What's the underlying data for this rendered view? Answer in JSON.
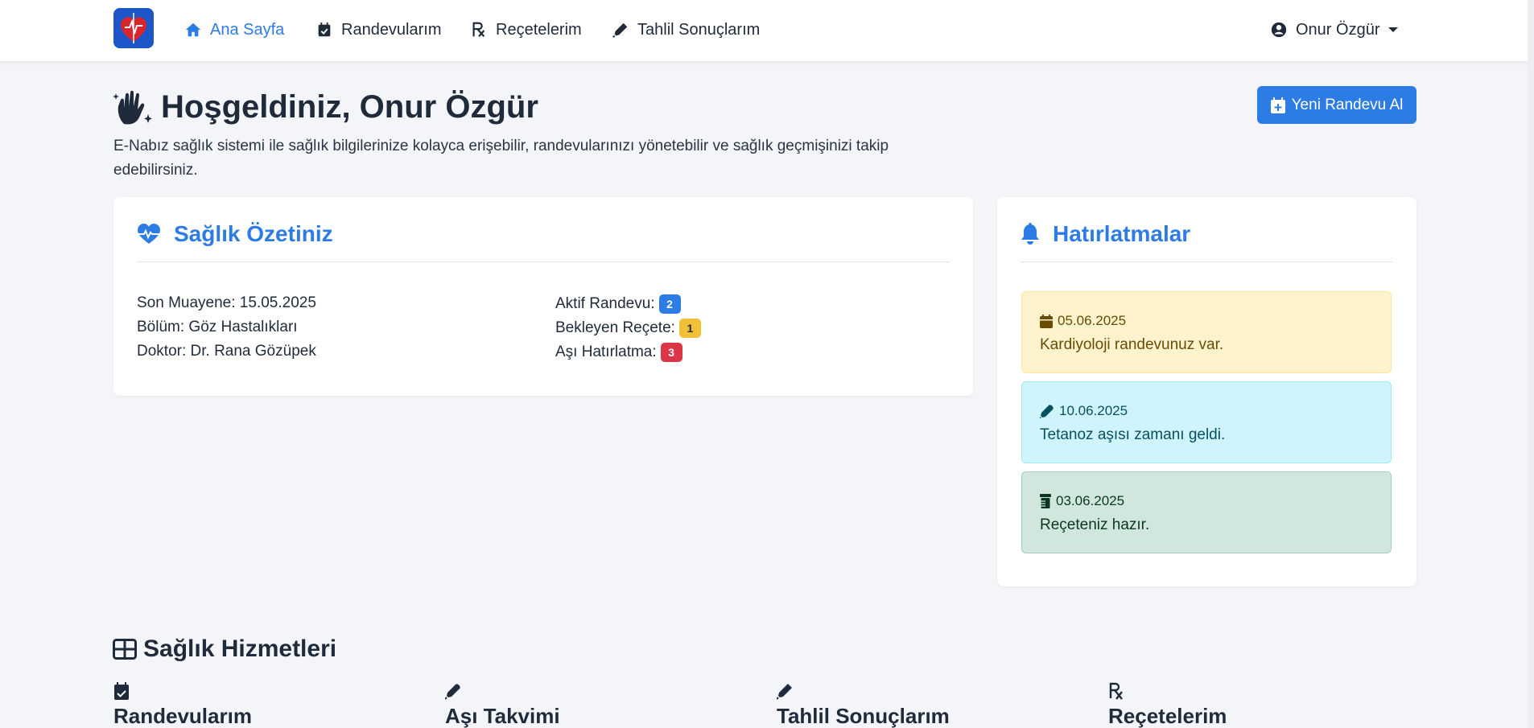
{
  "nav": {
    "items": [
      {
        "label": "Ana Sayfa",
        "icon": "home-icon",
        "active": true
      },
      {
        "label": "Randevularım",
        "icon": "calendar-check-icon",
        "active": false
      },
      {
        "label": "Reçetelerim",
        "icon": "prescription-icon",
        "active": false
      },
      {
        "label": "Tahlil Sonuçlarım",
        "icon": "syringe-icon",
        "active": false
      }
    ],
    "user_name": "Onur Özgür"
  },
  "header": {
    "title": "Hoşgeldiniz, Onur Özgür",
    "description": "E-Nabız sağlık sistemi ile sağlık bilgilerinize kolayca erişebilir, randevularınızı yönetebilir ve sağlık geçmişinizi takip edebilirsiniz.",
    "new_appointment_label": "Yeni Randevu Al"
  },
  "summary": {
    "title": "Sağlık Özetiniz",
    "left": [
      "Son Muayene: 15.05.2025",
      "Bölüm: Göz Hastalıkları",
      "Doktor: Dr. Rana Gözüpek"
    ],
    "right": [
      {
        "label": "Aktif Randevu:",
        "badge": "2",
        "color": "#2d7be5"
      },
      {
        "label": "Bekleyen Reçete:",
        "badge": "1",
        "color": "#f2c037"
      },
      {
        "label": "Aşı Hatırlatma:",
        "badge": "3",
        "color": "#dc3545"
      }
    ]
  },
  "reminders": {
    "title": "Hatırlatmalar",
    "items": [
      {
        "date": "05.06.2025",
        "text": "Kardiyoloji randevunuz var.",
        "icon": "calendar-icon"
      },
      {
        "date": "10.06.2025",
        "text": "Tetanoz aşısı zamanı geldi.",
        "icon": "syringe-icon"
      },
      {
        "date": "03.06.2025",
        "text": "Reçeteniz hazır.",
        "icon": "prescription-bottle-icon"
      }
    ]
  },
  "services": {
    "title": "Sağlık Hizmetleri",
    "items": [
      {
        "label": "Randevularım",
        "icon": "calendar-check-icon"
      },
      {
        "label": "Aşı Takvimi",
        "icon": "syringe-icon"
      },
      {
        "label": "Tahlil Sonuçlarım",
        "icon": "syringe-icon"
      },
      {
        "label": "Reçetelerim",
        "icon": "prescription-icon"
      }
    ]
  },
  "colors": {
    "primary": "#2d7be5",
    "warning_bg": "#fff3cd",
    "info_bg": "#cff4fc",
    "success_bg": "#d1e7dd"
  }
}
